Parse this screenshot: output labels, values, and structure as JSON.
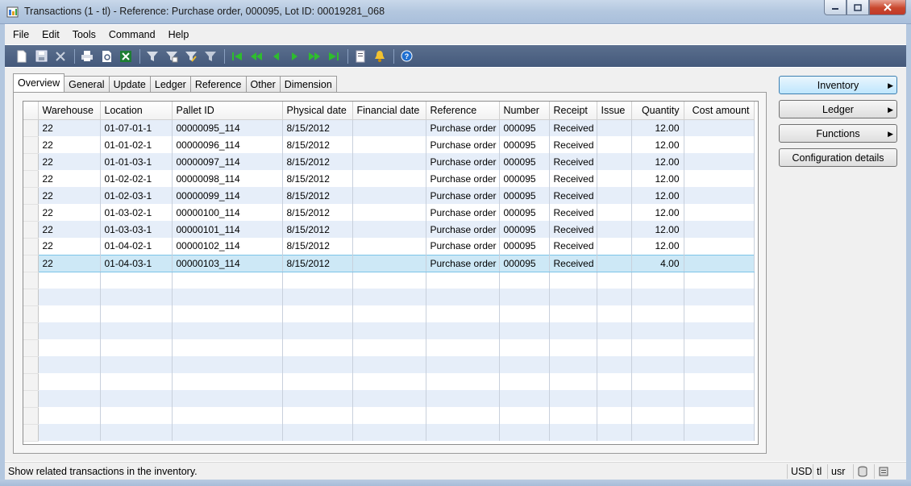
{
  "window": {
    "title": "Transactions (1 - tl) - Reference: Purchase order, 000095, Lot ID: 00019281_068"
  },
  "menu": [
    "File",
    "Edit",
    "Tools",
    "Command",
    "Help"
  ],
  "toolbar_icons": [
    "new-icon",
    "save-icon",
    "delete-icon",
    "print-icon",
    "print-preview-icon",
    "export-excel-icon",
    "filter-by-selection-icon",
    "filter-by-grid-icon",
    "advanced-filter-icon",
    "remove-filter-icon",
    "first-record-icon",
    "previous-page-icon",
    "previous-record-icon",
    "next-record-icon",
    "next-page-icon",
    "last-record-icon",
    "document-handling-icon",
    "alert-icon",
    "help-icon"
  ],
  "tabs": [
    "Overview",
    "General",
    "Update",
    "Ledger",
    "Reference",
    "Other",
    "Dimension"
  ],
  "active_tab": "Overview",
  "grid": {
    "columns": [
      "Warehouse",
      "Location",
      "Pallet ID",
      "Physical date",
      "Financial date",
      "Reference",
      "Number",
      "Receipt",
      "Issue",
      "Quantity",
      "Cost amount"
    ],
    "rows": [
      [
        "22",
        "01-07-01-1",
        "00000095_114",
        "8/15/2012",
        "",
        "Purchase order",
        "000095",
        "Received",
        "",
        "12.00",
        ""
      ],
      [
        "22",
        "01-01-02-1",
        "00000096_114",
        "8/15/2012",
        "",
        "Purchase order",
        "000095",
        "Received",
        "",
        "12.00",
        ""
      ],
      [
        "22",
        "01-01-03-1",
        "00000097_114",
        "8/15/2012",
        "",
        "Purchase order",
        "000095",
        "Received",
        "",
        "12.00",
        ""
      ],
      [
        "22",
        "01-02-02-1",
        "00000098_114",
        "8/15/2012",
        "",
        "Purchase order",
        "000095",
        "Received",
        "",
        "12.00",
        ""
      ],
      [
        "22",
        "01-02-03-1",
        "00000099_114",
        "8/15/2012",
        "",
        "Purchase order",
        "000095",
        "Received",
        "",
        "12.00",
        ""
      ],
      [
        "22",
        "01-03-02-1",
        "00000100_114",
        "8/15/2012",
        "",
        "Purchase order",
        "000095",
        "Received",
        "",
        "12.00",
        ""
      ],
      [
        "22",
        "01-03-03-1",
        "00000101_114",
        "8/15/2012",
        "",
        "Purchase order",
        "000095",
        "Received",
        "",
        "12.00",
        ""
      ],
      [
        "22",
        "01-04-02-1",
        "00000102_114",
        "8/15/2012",
        "",
        "Purchase order",
        "000095",
        "Received",
        "",
        "12.00",
        ""
      ],
      [
        "22",
        "01-04-03-1",
        "00000103_114",
        "8/15/2012",
        "",
        "Purchase order",
        "000095",
        "Received",
        "",
        "4.00",
        ""
      ]
    ],
    "selected_row": 8
  },
  "side_buttons": {
    "inventory": "Inventory",
    "ledger": "Ledger",
    "functions": "Functions",
    "configuration": "Configuration details"
  },
  "status": {
    "message": "Show related transactions in the inventory.",
    "currency": "USD",
    "company": "tl",
    "user": "usr"
  },
  "colors": {
    "selected_row": "#cde8f6",
    "alt_row": "#e6eef9",
    "toolbar": "#4c6285"
  }
}
